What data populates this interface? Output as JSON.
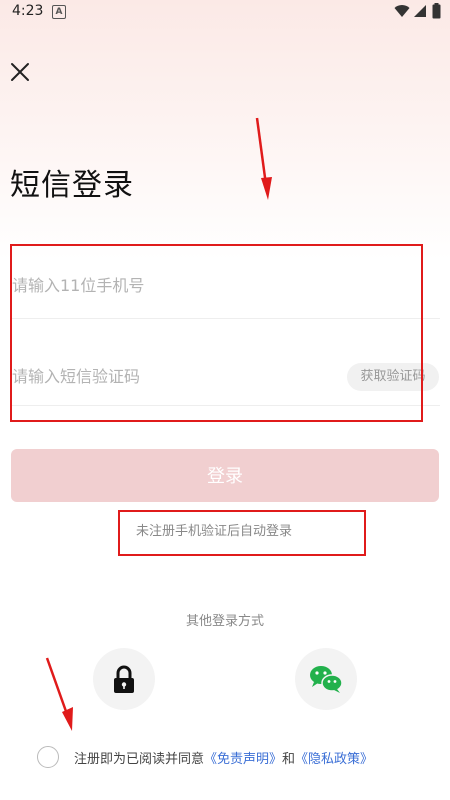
{
  "status_bar": {
    "time": "4:23",
    "notification_icon": "a-badge-icon",
    "icons": [
      "wifi-icon",
      "signal-icon",
      "battery-icon"
    ]
  },
  "header": {
    "close_icon": "close-icon",
    "title": "短信登录"
  },
  "form": {
    "phone_placeholder": "请输入11位手机号",
    "phone_value": "",
    "code_placeholder": "请输入短信验证码",
    "code_value": "",
    "get_code_label": "获取验证码",
    "login_label": "登录",
    "hint": "未注册手机验证后自动登录"
  },
  "other_login": {
    "label": "其他登录方式",
    "methods": [
      {
        "name": "lock-icon"
      },
      {
        "name": "wechat-icon"
      }
    ]
  },
  "agreement": {
    "checked": false,
    "prefix": "注册即为已阅读并同意",
    "disclaimer": "《免责声明》",
    "connector": "和",
    "privacy": "《隐私政策》"
  },
  "colors": {
    "accent_disabled": "#f1cfd0",
    "link": "#3b6fd6",
    "annotation": "#e01b1b"
  }
}
